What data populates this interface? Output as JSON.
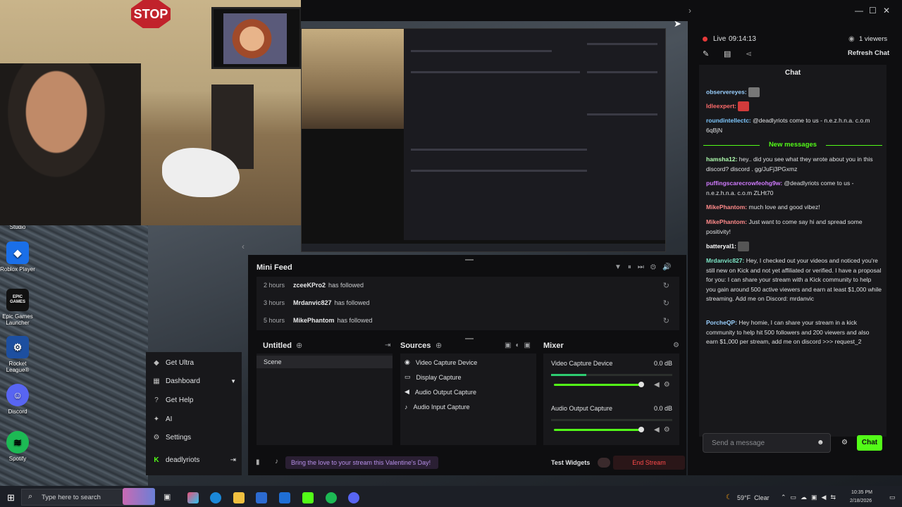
{
  "desktop": {
    "icons": [
      {
        "label": "Studio"
      },
      {
        "label": "Roblox Player"
      },
      {
        "label": "Epic Games Launcher",
        "glyph": "EPIC GAMES"
      },
      {
        "label": "Rocket League®"
      },
      {
        "label": "Discord"
      },
      {
        "label": "Spotify"
      }
    ],
    "stop_sign": "STOP"
  },
  "window": {
    "minimize": "—",
    "maximize": "☐",
    "close": "✕"
  },
  "sidebar": {
    "items": [
      {
        "label": "Get Ultra",
        "icon": "diamond-icon"
      },
      {
        "label": "Dashboard",
        "icon": "dashboard-icon"
      },
      {
        "label": "Get Help",
        "icon": "help-icon"
      },
      {
        "label": "AI",
        "icon": "sparkle-icon"
      },
      {
        "label": "Settings",
        "icon": "gear-icon"
      }
    ],
    "user": "deadlyriots",
    "collapse_glyph": "‹"
  },
  "mini_feed": {
    "title": "Mini Feed",
    "rows": [
      {
        "time": "2 hours",
        "name": "zceeKPro2",
        "action": "has followed"
      },
      {
        "time": "3 hours",
        "name": "Mrdanvic827",
        "action": "has followed"
      },
      {
        "time": "5 hours",
        "name": "MikePhantom",
        "action": "has followed"
      }
    ]
  },
  "scenes": {
    "title": "Untitled",
    "items": [
      "Scene"
    ]
  },
  "sources": {
    "title": "Sources",
    "items": [
      "Video Capture Device",
      "Display Capture",
      "Audio Output Capture",
      "Audio Input Capture"
    ]
  },
  "mixer": {
    "title": "Mixer",
    "channels": [
      {
        "name": "Video Capture Device",
        "db": "0.0 dB",
        "level": 0.29,
        "volume": 1.0
      },
      {
        "name": "Audio Output Capture",
        "db": "0.0 dB",
        "level": 0.0,
        "volume": 1.0
      }
    ]
  },
  "bottom_bar": {
    "banner": "Bring the love to your stream this Valentine's Day!",
    "test_widgets": "Test Widgets",
    "end_stream": "End Stream"
  },
  "stream": {
    "live_label": "Live",
    "timer": "09:14:13",
    "viewers": "1 viewers",
    "refresh_chat": "Refresh Chat"
  },
  "chat": {
    "title": "Chat",
    "new_messages": "New messages",
    "messages": [
      {
        "user": "observereyes:",
        "color": "#9ad0ff",
        "text": ""
      },
      {
        "user": "Idleexpert:",
        "color": "#ff6b6b",
        "text": ""
      },
      {
        "user": "roundintellectc:",
        "color": "#7ec8ff",
        "text": "@deadlyriots come to us - n.e.z.h.n.a. c.o.m 6qBjN"
      },
      {
        "user": "hamsha12:",
        "color": "#b0ffb0",
        "text": "hey.. did you see what they wrote about you in this discord? discord . gg/JuFj3PGxmz"
      },
      {
        "user": "puffingscarecrowfeohg9w:",
        "color": "#d17bff",
        "text": "@deadlyriots come to us - n.e.z.h.n.a. c.o.m ZLHt70"
      },
      {
        "user": "MikePhantom:",
        "color": "#ff8a8a",
        "text": "much love and good vibez!"
      },
      {
        "user": "MikePhantom:",
        "color": "#ff8a8a",
        "text": "Just want to come say hi and spread some positivity!"
      },
      {
        "user": "batteryal1:",
        "color": "#ffffff",
        "text": ""
      },
      {
        "user": "Mrdanvic827:",
        "color": "#7ee8c8",
        "text": "Hey, I checked out your videos and noticed you're still new on Kick and not yet affiliated or verified. I have a proposal for you: I can share your stream with a Kick community to help you gain around 500 active viewers and earn at least $1,000 while streaming. Add me on Discord: mrdanvic"
      },
      {
        "user": "PorcheQP:",
        "color": "#9ad0ff",
        "text": "Hey homie, I can share your stream in a kick community to help hit 500 followers and 200 viewers and also earn $1,000 per stream, add me on discord >>> request_2"
      }
    ],
    "input_placeholder": "Send a message",
    "send_label": "Chat"
  },
  "taskbar": {
    "search_placeholder": "Type here to search",
    "weather": "59°F  Clear",
    "time": "10:35 PM",
    "date": "2/18/2026"
  }
}
